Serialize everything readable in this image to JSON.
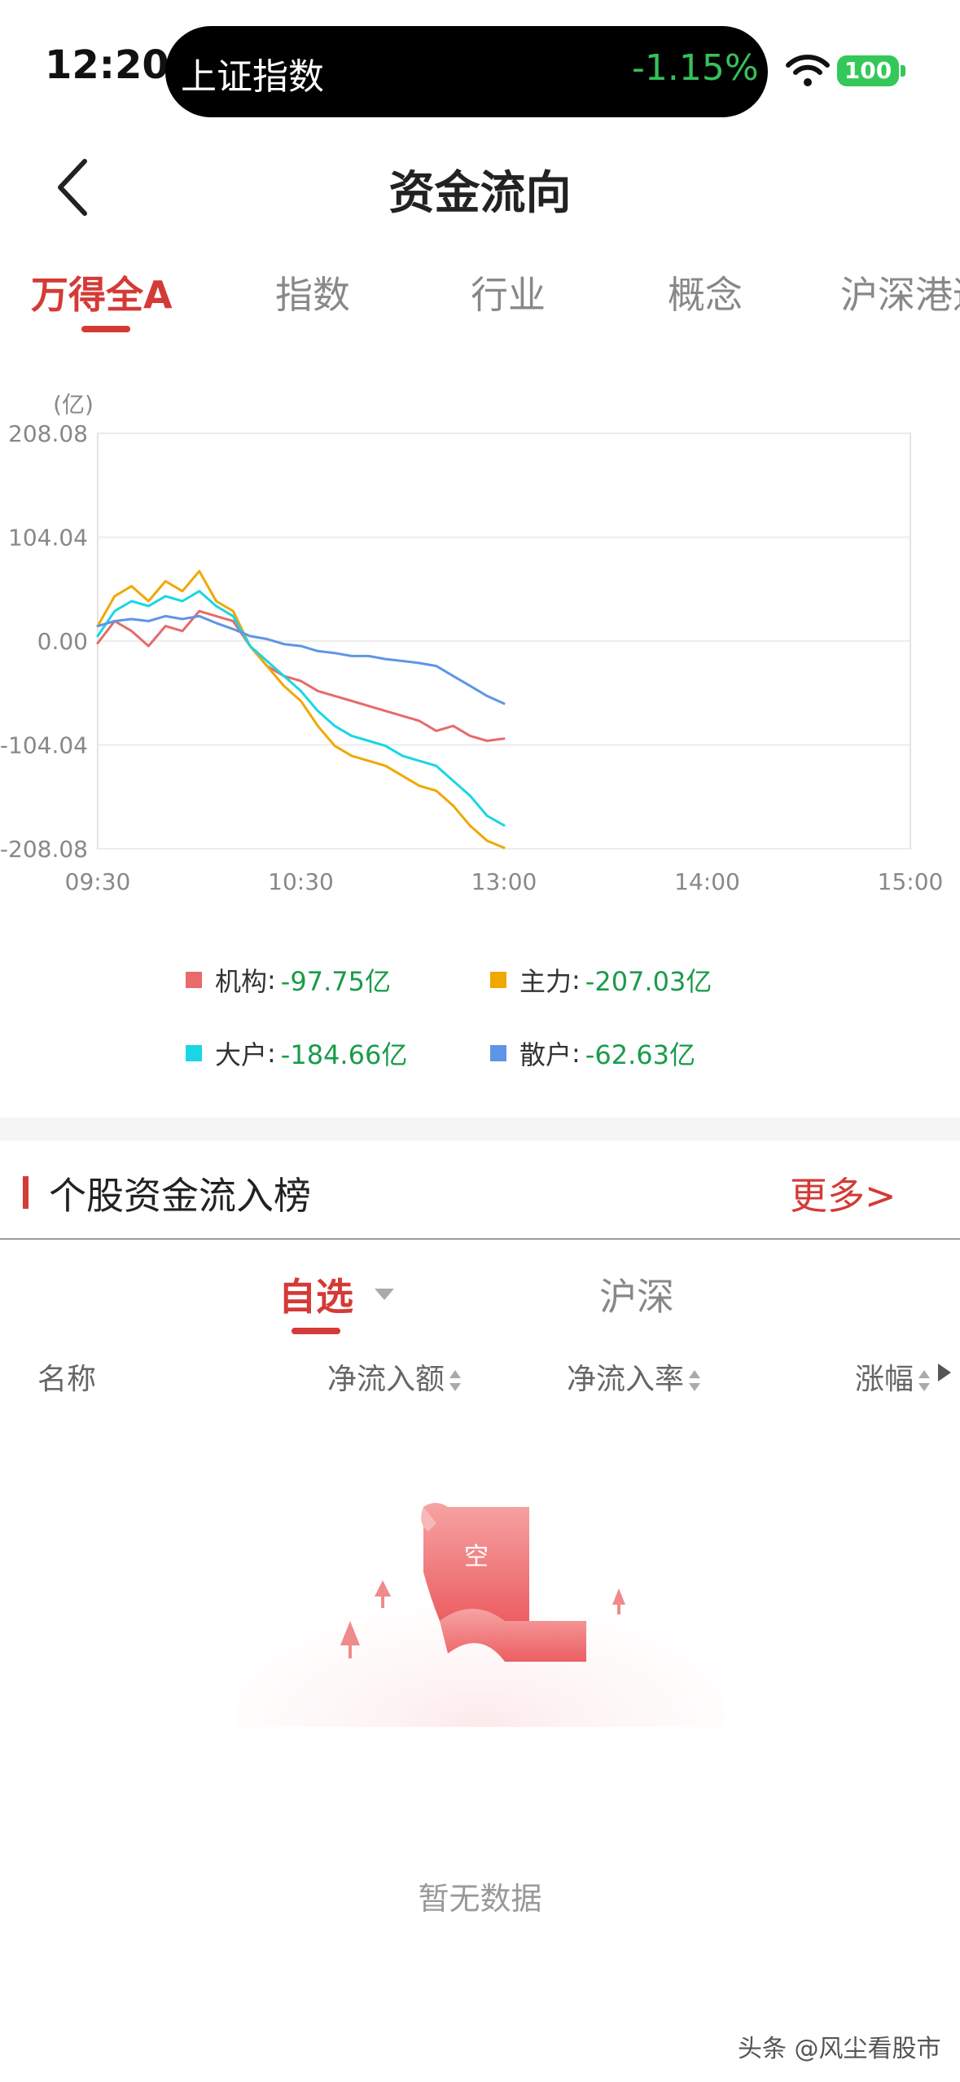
{
  "status_bar": {
    "time": "12:20",
    "ticker_label": "上证指数",
    "ticker_change": "-1.15%",
    "battery": "100"
  },
  "header": {
    "title": "资金流向"
  },
  "tabs": [
    {
      "label": "万得全A",
      "active": true
    },
    {
      "label": "指数",
      "active": false
    },
    {
      "label": "行业",
      "active": false
    },
    {
      "label": "概念",
      "active": false
    },
    {
      "label": "沪深港通",
      "active": false
    }
  ],
  "chart_data": {
    "type": "line",
    "unit_label": "(亿)",
    "y_ticks": [
      "208.08",
      "104.04",
      "0.00",
      "-104.04",
      "-208.08"
    ],
    "ylim": [
      -208.08,
      208.08
    ],
    "x_ticks": [
      "09:30",
      "10:30",
      "13:00",
      "14:00",
      "15:00"
    ],
    "x_note": "x in minutes of trading session (0 = 09:30, 240 = 15:00)",
    "xlim": [
      0,
      240
    ],
    "grid": true,
    "series": [
      {
        "name": "机构",
        "color": "#e86a6a",
        "x": [
          0,
          5,
          10,
          15,
          20,
          25,
          30,
          35,
          40,
          45,
          50,
          55,
          60,
          65,
          70,
          75,
          80,
          85,
          90,
          95,
          100,
          105,
          110,
          115,
          120
        ],
        "y": [
          -2,
          20,
          10,
          -5,
          15,
          10,
          30,
          25,
          20,
          -5,
          -25,
          -35,
          -40,
          -50,
          -55,
          -60,
          -65,
          -70,
          -75,
          -80,
          -90,
          -85,
          -95,
          -100,
          -97.75
        ]
      },
      {
        "name": "主力",
        "color": "#f0a800",
        "x": [
          0,
          5,
          10,
          15,
          20,
          25,
          30,
          35,
          40,
          45,
          50,
          55,
          60,
          65,
          70,
          75,
          80,
          85,
          90,
          95,
          100,
          105,
          110,
          115,
          120
        ],
        "y": [
          15,
          45,
          55,
          40,
          60,
          50,
          70,
          40,
          30,
          -5,
          -25,
          -45,
          -60,
          -85,
          -105,
          -115,
          -120,
          -125,
          -135,
          -145,
          -150,
          -165,
          -185,
          -200,
          -207.03
        ]
      },
      {
        "name": "大户",
        "color": "#19d6e6",
        "x": [
          0,
          5,
          10,
          15,
          20,
          25,
          30,
          35,
          40,
          45,
          50,
          55,
          60,
          65,
          70,
          75,
          80,
          85,
          90,
          95,
          100,
          105,
          110,
          115,
          120
        ],
        "y": [
          5,
          30,
          40,
          35,
          45,
          40,
          50,
          35,
          25,
          -5,
          -20,
          -35,
          -50,
          -70,
          -85,
          -95,
          -100,
          -105,
          -115,
          -120,
          -125,
          -140,
          -155,
          -175,
          -184.66
        ]
      },
      {
        "name": "散户",
        "color": "#5f95e6",
        "x": [
          0,
          5,
          10,
          15,
          20,
          25,
          30,
          35,
          40,
          45,
          50,
          55,
          60,
          65,
          70,
          75,
          80,
          85,
          90,
          95,
          100,
          105,
          110,
          115,
          120
        ],
        "y": [
          15,
          20,
          22,
          20,
          25,
          22,
          25,
          18,
          12,
          5,
          2,
          -3,
          -5,
          -10,
          -12,
          -15,
          -15,
          -18,
          -20,
          -22,
          -25,
          -35,
          -45,
          -55,
          -62.63
        ]
      }
    ]
  },
  "legend": [
    {
      "name": "机构",
      "value": "-97.75亿",
      "color": "#e86a6a"
    },
    {
      "name": "主力",
      "value": "-207.03亿",
      "color": "#f0a800"
    },
    {
      "name": "大户",
      "value": "-184.66亿",
      "color": "#19d6e6"
    },
    {
      "name": "散户",
      "value": "-62.63亿",
      "color": "#5f95e6"
    }
  ],
  "rank": {
    "title": "个股资金流入榜",
    "more": "更多>",
    "subtabs": [
      {
        "label": "自选",
        "active": true
      },
      {
        "label": "沪深",
        "active": false
      }
    ],
    "columns": [
      "名称",
      "净流入额",
      "净流入率",
      "涨幅"
    ],
    "empty_badge": "空",
    "empty_text": "暂无数据"
  },
  "watermark": "头条 @风尘看股市"
}
